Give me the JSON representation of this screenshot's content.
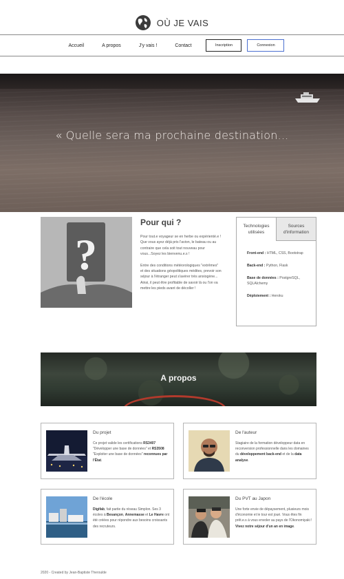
{
  "brand": {
    "name": "OÙ JE VAIS",
    "logo_icon": "globe-icon"
  },
  "nav": {
    "links": [
      "Accueil",
      "A propos",
      "J'y vais !",
      "Contact"
    ],
    "inscription": "Inscription",
    "connexion": "Connexion"
  },
  "hero": {
    "quote": "« Quelle sera ma prochaine destination..."
  },
  "pour_qui": {
    "title": "Pour qui ?",
    "p1": "Pour tout.e voyageur se en herbe ou expérienté.e ! Que vous ayez déjà pris l'avion, le bateau ou au contraire que cela soit tout nouveau pour vous...Soyez les bienvenu.e.s !",
    "p2": "Entre des conditions météorologiques \"extrêmes\" et des situations géopolitiques médites, prevoir son séjour à l'étranger peut s'avérer très anxiogène... Ainsi, il peut être profitable de savoir là ou l'on va mettre les pieds avant de décoller !"
  },
  "tabs": {
    "tab1": "Technologies utilisées",
    "tab2": "Sources d'information",
    "rows": [
      {
        "label": "Front-end :",
        "value": "HTML, CSS, Bootstrap"
      },
      {
        "label": "Back-end :",
        "value": "Python, Flask"
      },
      {
        "label": "Base de données :",
        "value": "PostgreSQL, SQLAlchemy"
      },
      {
        "label": "Déploiement :",
        "value": "Heroku"
      }
    ]
  },
  "apropos": {
    "title": "A propos"
  },
  "cards": {
    "projet": {
      "title": "Du projet",
      "t1": "Ce projet valide les certifications ",
      "b1": "RS3407",
      "t2": " \"Développer une base de données\" et ",
      "b2": "RS3508",
      "t3": " \"Exploiter une base de données\" ",
      "b3": "reconnues par l'État",
      "t4": "."
    },
    "auteur": {
      "title": "De l'auteur",
      "t1": "Stagiaire de la formation développeur data en reconversion professionnelle dans les domaines du ",
      "b1": "développement back-end",
      "t2": " et de la ",
      "b2": "data analyse",
      "t3": "."
    },
    "ecole": {
      "title": "De l'école",
      "b1": "Digifab",
      "t1": ", fait partie du réseau Simplon. Ses 3 écoles à ",
      "b2": "Besançon",
      "t2": ", ",
      "b3": "Annemasse",
      "t3": " et ",
      "b4": "Le Havre",
      "t4": " ont été créées pour répondre aux besoins croissants des recruteurs."
    },
    "pvt": {
      "title": "Du PVT au Japon",
      "t1": "Une forte envie de dépaysement, plusieurs mois d'économie et le tour est joué. Vous êtes fin prêt.e.s à vous envoler au pays de l'Okonomiyaki ! ",
      "b1": "Vivez notre séjour d'un an en image",
      "t2": "."
    }
  },
  "footer": {
    "text": "2020 - Created by Jean-Baptiste Theroulde"
  }
}
